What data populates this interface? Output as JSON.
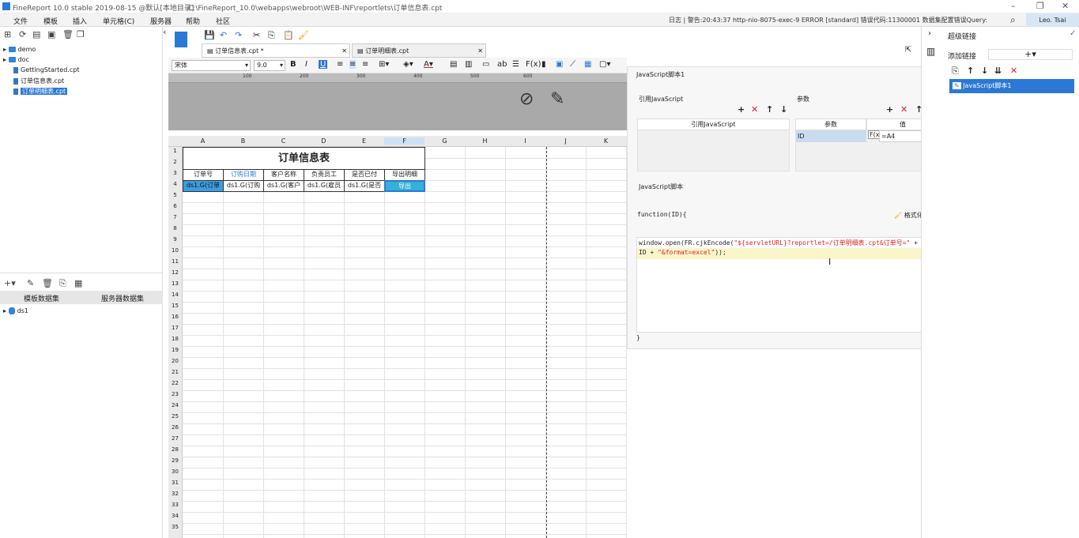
{
  "titlebar": {
    "app": "FineReport 10.0 stable 2019-08-15 @默认[本地目录]",
    "path": "C:\\FineReport_10.0\\webapps\\webroot\\WEB-INF\\reportlets\\订单信息表.cpt"
  },
  "menu": {
    "items": [
      "文件",
      "模板",
      "插入",
      "单元格(C)",
      "服务器",
      "帮助",
      "社区"
    ],
    "log": "日志 | 警告:20:43:37 http-nio-8075-exec-9 ERROR [standard] 错误代码:11300001 数据集配置错误Query:",
    "user": "Leo. Tsai"
  },
  "tree": [
    {
      "label": "demo",
      "type": "folder"
    },
    {
      "label": "doc",
      "type": "folder"
    },
    {
      "label": "GettingStarted.cpt",
      "type": "file"
    },
    {
      "label": "订单信息表.cpt",
      "type": "file"
    },
    {
      "label": "订单明细表.cpt",
      "type": "file",
      "selected": true
    }
  ],
  "datasets": {
    "tab_template": "模板数据集",
    "tab_server": "服务器数据集",
    "items": [
      "ds1"
    ]
  },
  "tabs": [
    {
      "label": "订单信息表.cpt *",
      "active": true
    },
    {
      "label": "订单明细表.cpt",
      "active": false
    }
  ],
  "format": {
    "font": "宋体",
    "size": "9.0"
  },
  "ruler": [
    "100",
    "200",
    "300",
    "400",
    "500",
    "600"
  ],
  "columns": [
    "A",
    "B",
    "C",
    "D",
    "E",
    "F",
    "G",
    "H",
    "I",
    "J",
    "K"
  ],
  "rows": [
    "1",
    "2",
    "3",
    "4",
    "5",
    "6",
    "7",
    "8",
    "9",
    "10",
    "11",
    "12",
    "13",
    "14",
    "15",
    "16",
    "17",
    "18",
    "19",
    "20",
    "21",
    "22",
    "23",
    "24",
    "25",
    "26",
    "27",
    "28",
    "29",
    "30",
    "31",
    "32",
    "33",
    "34",
    "35"
  ],
  "sheet": {
    "title": "订单信息表",
    "headers": [
      "订单号",
      "订购日期",
      "客户名称",
      "负责员工",
      "是否已付",
      "导出明细"
    ],
    "data_row": [
      "ds1.G(订单",
      "ds1.G(订购",
      "ds1.G(客户",
      "ds1.G(雇员",
      "ds1.G(是否",
      "导出"
    ]
  },
  "jsdialog": {
    "title": "JavaScript脚本1",
    "ref_label": "引用JavaScript",
    "ref_col": "引用JavaScript",
    "params_label": "参数",
    "param_col": "参数",
    "value_col": "值",
    "param_name": "ID",
    "param_value": "=A4",
    "script_label": "JavaScript脚本",
    "func_open": "function(ID){",
    "format_code": "格式化代码",
    "code_line1_a": "window.open(FR.cjkEncode(",
    "code_line1_b": "\"${servletURL}?reportlet=/订单明细表.cpt&订单号=\"",
    "code_line1_c": " +",
    "code_line2_a": "ID + ",
    "code_line2_b": "\"&format=excel\"",
    "code_line2_c": "));",
    "func_close": "}"
  },
  "rightpanel": {
    "title": "超级链接",
    "add_link": "添加链接",
    "items": [
      "JavaScript脚本1"
    ]
  }
}
